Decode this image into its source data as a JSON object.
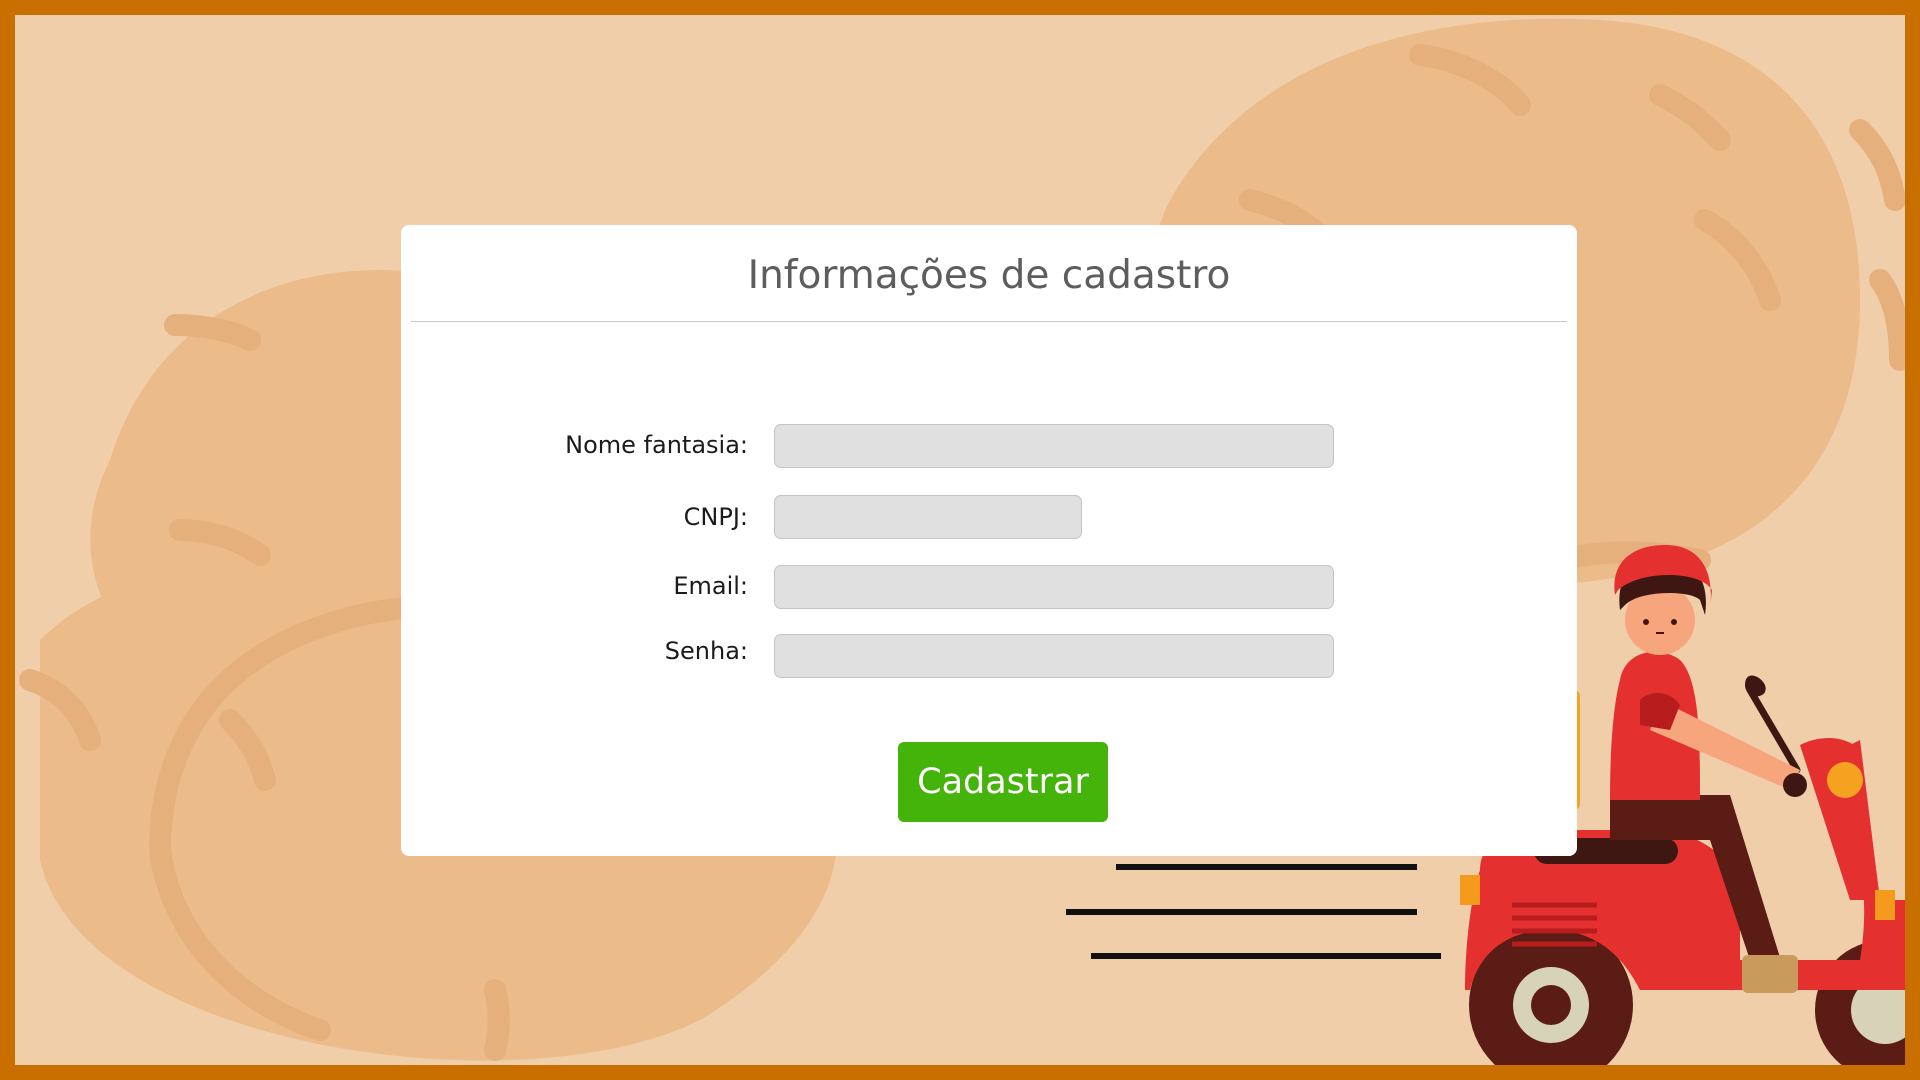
{
  "form": {
    "title": "Informações de cadastro",
    "fields": [
      {
        "label": "Nome fantasia:",
        "value": "",
        "placeholder": ""
      },
      {
        "label": "CNPJ:",
        "value": "",
        "placeholder": ""
      },
      {
        "label": "Email:",
        "value": "",
        "placeholder": ""
      },
      {
        "label": "Senha:",
        "value": "",
        "placeholder": ""
      }
    ],
    "submit_label": "Cadastrar"
  },
  "illustration": {
    "description_icon": "delivery-scooter-icon"
  },
  "colors": {
    "border": "#c96f00",
    "background": "#f0ceaa",
    "pattern": "#ebbb8a",
    "button": "#44b40a",
    "scooter": "#e53030"
  }
}
